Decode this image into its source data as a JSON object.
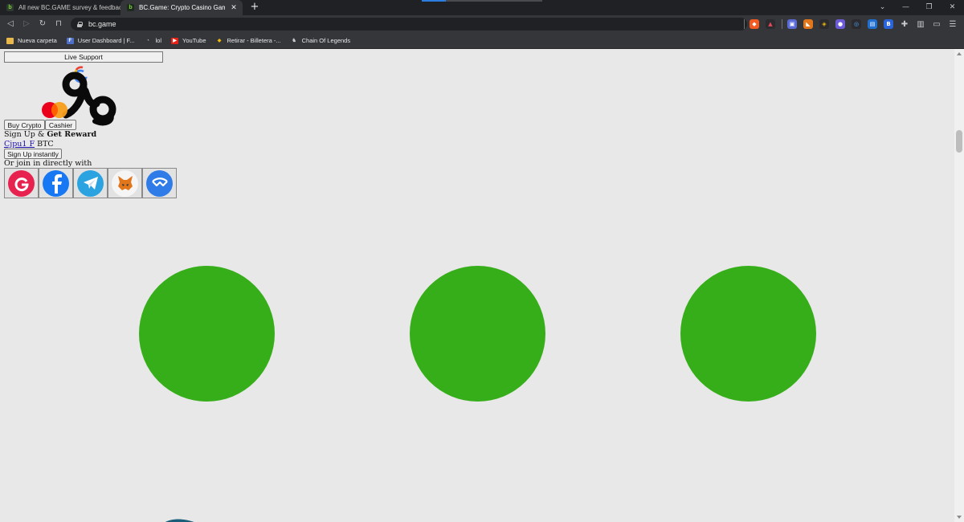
{
  "browser": {
    "tabs": [
      {
        "title": "All new BC.GAME survey & feedback"
      },
      {
        "title": "BC.Game: Crypto Casino Games &"
      }
    ],
    "url": "bc.game",
    "bookmarks": [
      {
        "label": "Nueva carpeta",
        "icon": "folder-icon"
      },
      {
        "label": "User Dashboard | F...",
        "icon": "dashboard-icon"
      },
      {
        "label": "lol",
        "icon": "gauge-icon"
      },
      {
        "label": "YouTube",
        "icon": "youtube-icon"
      },
      {
        "label": "Retirar - Billetera -...",
        "icon": "binance-icon"
      },
      {
        "label": "Chain Of Legends",
        "icon": "legends-icon"
      }
    ]
  },
  "page": {
    "live_support": "Live Support",
    "buy_crypto": "Buy Crypto",
    "cashier": "Cashier",
    "signup_prefix": "Sign Up & ",
    "signup_bold": "Get Reward",
    "reward_link": "Cjpu1 F",
    "reward_suffix": "BTC",
    "signup_button": "Sign Up instantly",
    "join_text": "Or join in directly with",
    "social": [
      {
        "name": "google",
        "color": "#e8224f"
      },
      {
        "name": "facebook",
        "color": "#1877f2"
      },
      {
        "name": "telegram",
        "color": "#2aa3e0"
      },
      {
        "name": "metamask",
        "color": "#f5f5f5"
      },
      {
        "name": "walletconnect",
        "color": "#2f7ce8"
      }
    ],
    "loader_color": "#36ae19"
  }
}
